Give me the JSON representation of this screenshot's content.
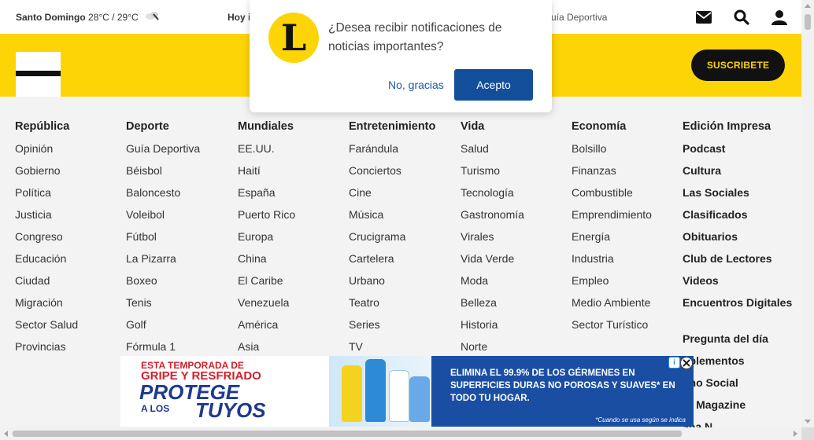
{
  "topbar": {
    "city": "Santo Domingo",
    "temps": "28°C / 29°C",
    "hoy": "Hoy i",
    "guia_partial": "uía Deportiva",
    "icons": [
      "envelope-icon",
      "search-icon",
      "user-icon"
    ]
  },
  "header": {
    "subscribe_label": "SUSCRIBETE"
  },
  "nav": {
    "columns": [
      {
        "head": "República",
        "items": [
          "Opinión",
          "Gobierno",
          "Política",
          "Justicia",
          "Congreso",
          "Educación",
          "Ciudad",
          "Migración",
          "Sector Salud",
          "Provincias"
        ]
      },
      {
        "head": "Deporte",
        "items": [
          "Guía Deportiva",
          "Béisbol",
          "Baloncesto",
          "Voleibol",
          "Fútbol",
          "La Pizarra",
          "Boxeo",
          "Tenis",
          "Golf",
          "Fórmula 1"
        ]
      },
      {
        "head": "Mundiales",
        "items": [
          "EE.UU.",
          "Haití",
          "España",
          "Puerto Rico",
          "Europa",
          "China",
          "El Caribe",
          "Venezuela",
          "América",
          "Asia"
        ]
      },
      {
        "head": "Entretenimiento",
        "items": [
          "Farándula",
          "Conciertos",
          "Cine",
          "Música",
          "Crucigrama",
          "Cartelera",
          "Urbano",
          "Teatro",
          "Series",
          "TV"
        ]
      },
      {
        "head": "Vida",
        "items": [
          "Salud",
          "Turismo",
          "Tecnología",
          "Gastronomía",
          "Virales",
          "Vida Verde",
          "Moda",
          "Belleza",
          "Historia",
          "Norte"
        ]
      },
      {
        "head": "Economía",
        "items": [
          "Bolsillo",
          "Finanzas",
          "Combustible",
          "Emprendimiento",
          "Energía",
          "Industria",
          "Empleo",
          "Medio Ambiente",
          "Sector Turístico"
        ]
      },
      {
        "head": "Edición Impresa",
        "items": [
          "Podcast",
          "Cultura",
          "Las Sociales",
          "Clasificados",
          "Obituarios",
          "Club de Lectores",
          "Videos",
          "Encuentros Digitales",
          "Pregunta del día",
          "uplementos",
          "tmo Social",
          "n! Magazine",
          "ana N"
        ]
      }
    ]
  },
  "modal": {
    "logo_letter": "L",
    "message": "¿Desea recibir notificaciones de noticias importantes?",
    "no_label": "No, gracias",
    "yes_label": "Acepto"
  },
  "ad": {
    "line1": "ESTA TEMPORADA DE",
    "line2": "GRIPE Y RESFRIADO",
    "line3": "PROTEGE",
    "line4": "A LOS",
    "line5": "TUYOS",
    "right_text": "ELIMINA EL 99.9% DE LOS GÉRMENES EN SUPERFICIES DURAS NO POROSAS Y SUAVES* EN TODO TU HOGAR.",
    "note": "*Cuando se usa según se indica",
    "choice_label": "i"
  },
  "colors": {
    "brand_yellow": "#fdd406",
    "button_blue": "#134e9a",
    "ad_blue": "#1a4ea3"
  }
}
